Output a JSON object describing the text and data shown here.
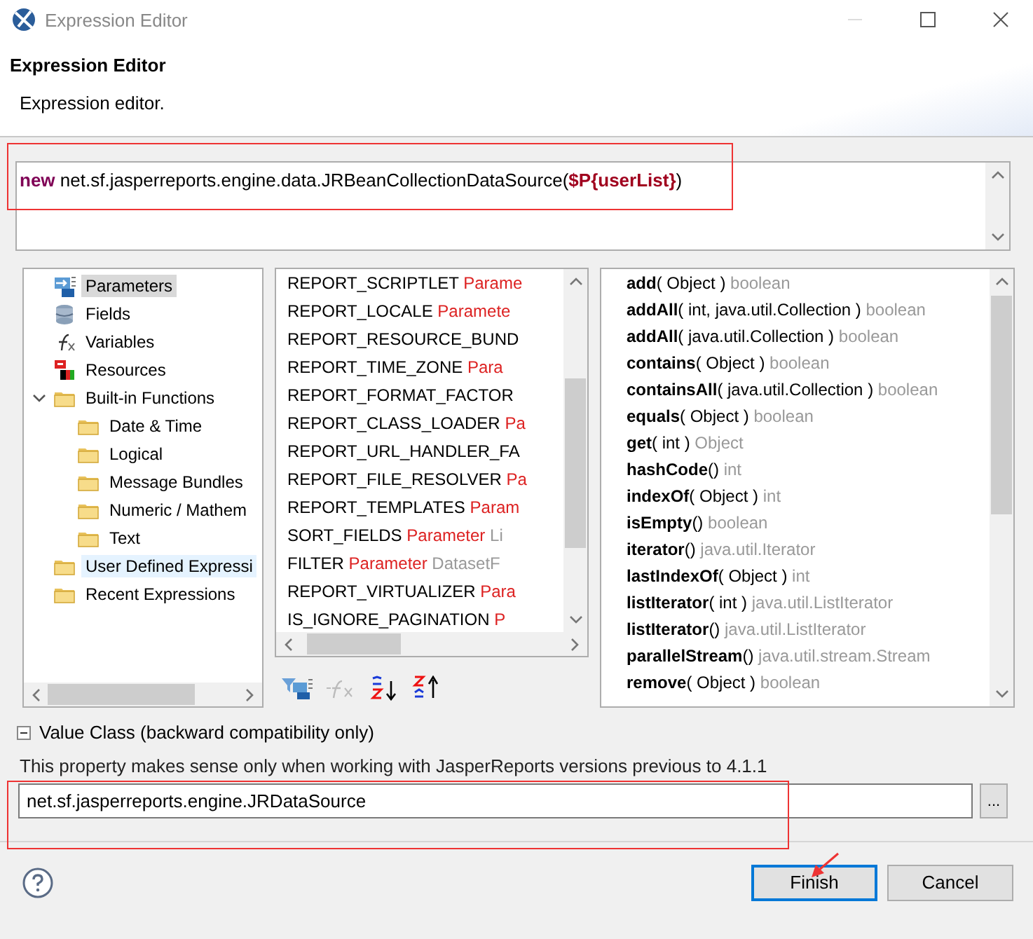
{
  "window": {
    "title": "Expression Editor"
  },
  "header": {
    "title": "Expression Editor",
    "description": "Expression editor."
  },
  "expression": {
    "tokens": [
      {
        "kind": "keyword",
        "text": "new"
      },
      {
        "kind": "plain",
        "text": " net.sf.jasperreports.engine.data.JRBeanCollectionDataSource("
      },
      {
        "kind": "param",
        "text": "$P{userList}"
      },
      {
        "kind": "plain",
        "text": ")"
      }
    ]
  },
  "tree": [
    {
      "label": "Parameters",
      "kind": "parameters",
      "selected": true,
      "hovered": false
    },
    {
      "label": "Fields",
      "kind": "fields",
      "selected": false,
      "hovered": false
    },
    {
      "label": "Variables",
      "kind": "variables",
      "selected": false,
      "hovered": false
    },
    {
      "label": "Resources",
      "kind": "resources",
      "selected": false,
      "hovered": false
    },
    {
      "label": "Built-in Functions",
      "kind": "folder",
      "selected": false,
      "hovered": false,
      "expanded": true,
      "children": [
        {
          "label": "Date & Time",
          "kind": "folder",
          "selected": false,
          "hovered": false
        },
        {
          "label": "Logical",
          "kind": "folder",
          "selected": false,
          "hovered": false
        },
        {
          "label": "Message Bundles",
          "kind": "folder",
          "selected": false,
          "hovered": false
        },
        {
          "label": "Numeric / Mathem",
          "kind": "folder",
          "selected": false,
          "hovered": false
        },
        {
          "label": "Text",
          "kind": "folder",
          "selected": false,
          "hovered": false
        }
      ]
    },
    {
      "label": "User Defined Expressi",
      "kind": "folder",
      "selected": false,
      "hovered": true
    },
    {
      "label": "Recent Expressions",
      "kind": "folder",
      "selected": false,
      "hovered": false
    }
  ],
  "objects": [
    {
      "name": "REPORT_SCRIPTLET",
      "type": "Parame"
    },
    {
      "name": "REPORT_LOCALE",
      "type": "Paramete"
    },
    {
      "name": "REPORT_RESOURCE_BUND"
    },
    {
      "name": "REPORT_TIME_ZONE",
      "type": "Para"
    },
    {
      "name": "REPORT_FORMAT_FACTOR"
    },
    {
      "name": "REPORT_CLASS_LOADER",
      "type": "Pa"
    },
    {
      "name": "REPORT_URL_HANDLER_FA"
    },
    {
      "name": "REPORT_FILE_RESOLVER",
      "type": "Pa"
    },
    {
      "name": "REPORT_TEMPLATES",
      "type": "Param"
    },
    {
      "name": "SORT_FIELDS",
      "type": "Parameter",
      "class": "Li"
    },
    {
      "name": "FILTER",
      "type": "Parameter",
      "class": "DatasetF"
    },
    {
      "name": "REPORT_VIRTUALIZER",
      "type": "Para"
    },
    {
      "name": "IS_IGNORE_PAGINATION",
      "type": "P"
    }
  ],
  "methods": [
    {
      "name": "add",
      "args": "( Object )",
      "returns": "boolean"
    },
    {
      "name": "addAll",
      "args": "( int, java.util.Collection )",
      "returns": "boolean"
    },
    {
      "name": "addAll",
      "args": "( java.util.Collection )",
      "returns": "boolean"
    },
    {
      "name": "contains",
      "args": "( Object )",
      "returns": "boolean"
    },
    {
      "name": "containsAll",
      "args": "( java.util.Collection )",
      "returns": "boolean"
    },
    {
      "name": "equals",
      "args": "( Object )",
      "returns": "boolean"
    },
    {
      "name": "get",
      "args": "( int )",
      "returns": "Object"
    },
    {
      "name": "hashCode",
      "args": "()",
      "returns": "int"
    },
    {
      "name": "indexOf",
      "args": "( Object )",
      "returns": "int"
    },
    {
      "name": "isEmpty",
      "args": "()",
      "returns": "boolean"
    },
    {
      "name": "iterator",
      "args": "()",
      "returns": "java.util.Iterator"
    },
    {
      "name": "lastIndexOf",
      "args": "( Object )",
      "returns": "int"
    },
    {
      "name": "listIterator",
      "args": "( int )",
      "returns": "java.util.ListIterator"
    },
    {
      "name": "listIterator",
      "args": "()",
      "returns": "java.util.ListIterator"
    },
    {
      "name": "parallelStream",
      "args": "()",
      "returns": "java.util.stream.Stream"
    },
    {
      "name": "remove",
      "args": "( Object )",
      "returns": "boolean"
    }
  ],
  "value_class": {
    "title": "Value Class (backward compatibility only)",
    "expanded": true,
    "note": "This property makes sense only when working with JasperReports versions previous to 4.1.1",
    "value": "net.sf.jasperreports.engine.JRDataSource",
    "browse": "..."
  },
  "buttons": [
    {
      "label": "Finish",
      "default": true
    },
    {
      "label": "Cancel",
      "default": false
    }
  ]
}
